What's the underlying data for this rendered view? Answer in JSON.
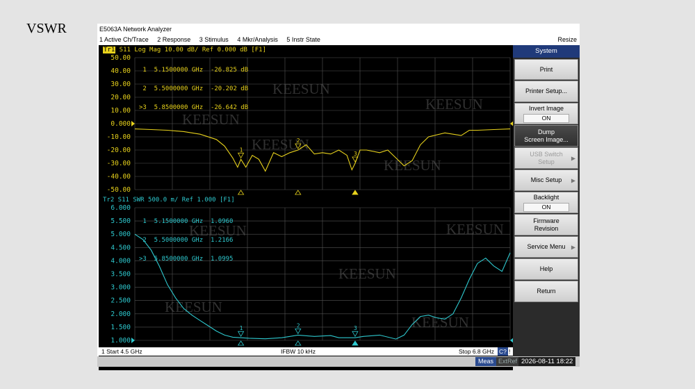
{
  "caption": "VSWR",
  "window": {
    "title": "E5063A Network Analyzer",
    "menu": [
      "1 Active Ch/Trace",
      "2 Response",
      "3 Stimulus",
      "4 Mkr/Analysis",
      "5 Instr State"
    ],
    "resize": "Resize"
  },
  "trace1": {
    "badge": "Tr1",
    "header": " S11 Log Mag 10.00 dB/ Ref 0.000 dB [F1]",
    "ref_label": "0.000",
    "color": "#e8d21c",
    "yticks": [
      "50.00",
      "40.00",
      "30.00",
      "20.00",
      "10.00",
      "0.000",
      "-10.00",
      "-20.00",
      "-30.00",
      "-40.00",
      "-50.00"
    ],
    "markers": [
      {
        "id": "1",
        "freq": "5.1500000 GHz",
        "value": "-26.825 dB",
        "line": " 1  5.1500000 GHz  -26.825 dB"
      },
      {
        "id": "2",
        "freq": "5.5000000 GHz",
        "value": "-20.202 dB",
        "line": " 2  5.5000000 GHz  -20.202 dB"
      },
      {
        "id": "3",
        "freq": "5.8500000 GHz",
        "value": "-26.642 dB",
        "line": ">3  5.8500000 GHz  -26.642 dB"
      }
    ]
  },
  "trace2": {
    "header": "Tr2 S11 SWR 500.0 m/ Ref 1.000 [F1]",
    "ref_label": "1.000",
    "color": "#2ec9cf",
    "yticks": [
      "6.000",
      "5.500",
      "5.000",
      "4.500",
      "4.000",
      "3.500",
      "3.000",
      "2.500",
      "2.000",
      "1.500",
      "1.000"
    ],
    "markers": [
      {
        "id": "1",
        "freq": "5.1500000 GHz",
        "value": "1.0960",
        "line": " 1  5.1500000 GHz  1.0960"
      },
      {
        "id": "2",
        "freq": "5.5000000 GHz",
        "value": "1.2166",
        "line": " 2  5.5000000 GHz  1.2166"
      },
      {
        "id": "3",
        "freq": "5.8500000 GHz",
        "value": "1.0995",
        "line": ">3  5.8500000 GHz  1.0995"
      }
    ]
  },
  "watermark": "KEESUN",
  "status": {
    "start": "1  Start 4.5 GHz",
    "ifbw": "IFBW 10 kHz",
    "stop": "Stop 6.8 GHz",
    "c2": "C?",
    "excl": "!"
  },
  "bottom": {
    "meas": "Meas",
    "extref": "ExtRef",
    "datetime": "2026-08-11 18:22"
  },
  "softkeys": {
    "header": "System",
    "items": [
      {
        "label": "Print"
      },
      {
        "label": "Printer Setup..."
      },
      {
        "label": "Invert Image",
        "value": "ON"
      },
      {
        "label": "Dump",
        "label2": "Screen Image..."
      },
      {
        "label": "USB Switch",
        "label2": "Setup"
      },
      {
        "label": "Misc Setup"
      },
      {
        "label": "Backlight",
        "value": "ON"
      },
      {
        "label": "Firmware",
        "label2": "Revision"
      },
      {
        "label": "Service Menu"
      },
      {
        "label": "Help"
      },
      {
        "label": "Return"
      }
    ]
  },
  "chart_data": [
    {
      "type": "line",
      "ylabel": "",
      "xlabel": "",
      "xlim": [
        4.5,
        6.8
      ],
      "ylim": [
        -50,
        50
      ],
      "grid": true,
      "series": [
        {
          "values_x": [
            4.5,
            4.6,
            4.7,
            4.8,
            4.9,
            5.0,
            5.05,
            5.1,
            5.13,
            5.15,
            5.18,
            5.22,
            5.26,
            5.3,
            5.35,
            5.4,
            5.45,
            5.5,
            5.55,
            5.6,
            5.65,
            5.7,
            5.75,
            5.8,
            5.83,
            5.85,
            5.88,
            5.92,
            6.0,
            6.05,
            6.1,
            6.15,
            6.2,
            6.25,
            6.3,
            6.4,
            6.5,
            6.55,
            6.6,
            6.7,
            6.8
          ],
          "values_y": [
            -4,
            -4.5,
            -5,
            -6,
            -8,
            -12,
            -17,
            -26,
            -33,
            -27,
            -33,
            -24,
            -27,
            -36,
            -22,
            -25,
            -22,
            -20,
            -16,
            -23,
            -22,
            -23,
            -20,
            -24,
            -35,
            -30,
            -20,
            -20,
            -22,
            -20,
            -26,
            -32,
            -28,
            -16,
            -10,
            -7,
            -9,
            -5,
            -5,
            -4.5,
            -4
          ]
        }
      ]
    },
    {
      "type": "line",
      "ylabel": "",
      "xlabel": "",
      "xlim": [
        4.5,
        6.8
      ],
      "ylim": [
        1,
        6
      ],
      "grid": true,
      "series": [
        {
          "values_x": [
            4.5,
            4.55,
            4.6,
            4.65,
            4.7,
            4.75,
            4.8,
            4.85,
            4.9,
            4.95,
            5.0,
            5.05,
            5.1,
            5.15,
            5.2,
            5.3,
            5.4,
            5.5,
            5.6,
            5.7,
            5.75,
            5.8,
            5.85,
            5.9,
            6.0,
            6.1,
            6.15,
            6.2,
            6.25,
            6.3,
            6.35,
            6.4,
            6.45,
            6.5,
            6.55,
            6.6,
            6.65,
            6.7,
            6.75,
            6.8
          ],
          "values_y": [
            5.0,
            4.8,
            4.4,
            3.8,
            3.1,
            2.6,
            2.2,
            1.95,
            1.75,
            1.55,
            1.35,
            1.2,
            1.12,
            1.1,
            1.08,
            1.06,
            1.1,
            1.2,
            1.15,
            1.18,
            1.1,
            1.1,
            1.1,
            1.15,
            1.2,
            1.05,
            1.2,
            1.6,
            1.9,
            1.95,
            1.85,
            1.8,
            2.0,
            2.6,
            3.3,
            3.9,
            4.1,
            3.8,
            3.6,
            4.3
          ]
        }
      ]
    }
  ]
}
